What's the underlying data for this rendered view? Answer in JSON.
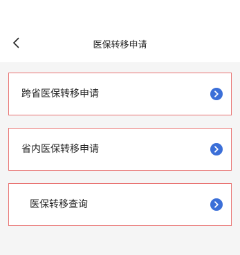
{
  "header": {
    "title": "医保转移申请"
  },
  "items": [
    {
      "label": "跨省医保转移申请"
    },
    {
      "label": "省内医保转移申请"
    },
    {
      "label": "医保转移查询"
    }
  ],
  "colors": {
    "accent_blue": "#3b6fd8",
    "card_border": "#e8706f",
    "page_background": "#f5f5f5"
  },
  "icons": {
    "back": "chevron-left-icon",
    "item_arrow": "chevron-right-circle-icon"
  }
}
